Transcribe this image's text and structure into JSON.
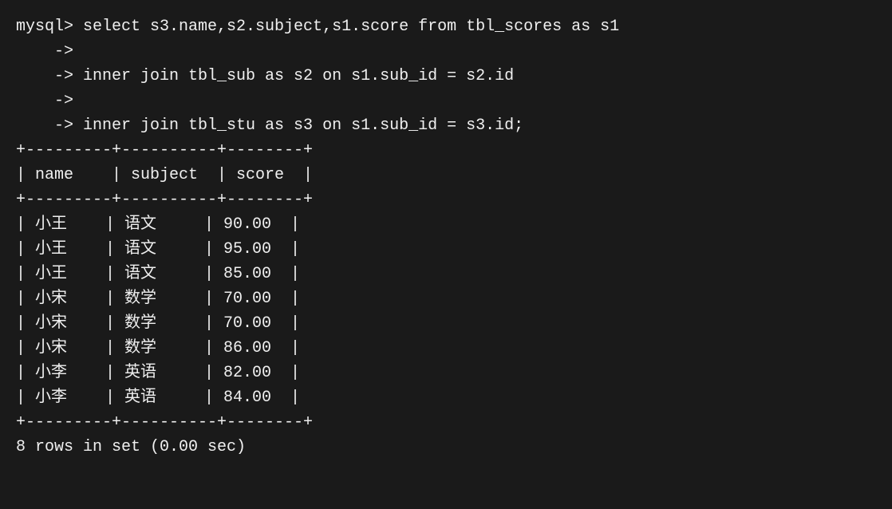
{
  "terminal": {
    "prompt": "mysql>",
    "lines": [
      "mysql> select s3.name,s2.subject,s1.score from tbl_scores as s1",
      "    ->",
      "    -> inner join tbl_sub as s2 on s1.sub_id = s2.id",
      "    ->",
      "    -> inner join tbl_stu as s3 on s1.sub_id = s3.id;",
      "+---------+----------+--------+",
      "| name    | subject  | score  |",
      "+---------+----------+--------+",
      "| 小王    | 语文     | 90.00  |",
      "| 小王    | 语文     | 95.00  |",
      "| 小王    | 语文     | 85.00  |",
      "| 小宋    | 数学     | 70.00  |",
      "| 小宋    | 数学     | 70.00  |",
      "| 小宋    | 数学     | 86.00  |",
      "| 小李    | 英语     | 82.00  |",
      "| 小李    | 英语     | 84.00  |",
      "+---------+----------+--------+",
      "8 rows in set (0.00 sec)"
    ]
  }
}
